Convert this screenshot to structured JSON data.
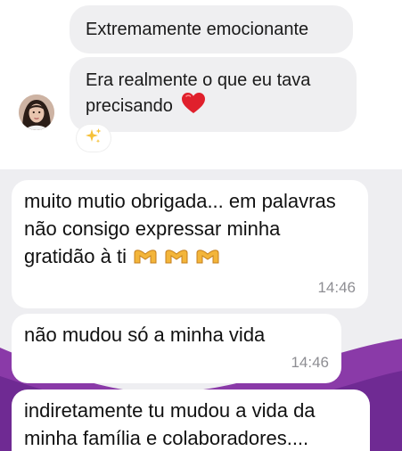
{
  "instagram": {
    "messages": [
      {
        "text": "Extremamente emocionante"
      },
      {
        "text": "Era realmente o que eu tava precisando"
      }
    ],
    "reaction": "sparkles",
    "icons": {
      "heart": "red-heart-icon",
      "reaction": "sparkles-icon",
      "avatar": "user-avatar"
    }
  },
  "whatsapp": {
    "messages": [
      {
        "text": "muito mutio obrigada... em palavras não consigo expressar minha gratidão à ti",
        "emoji": "heart-hands x3",
        "time": "14:46"
      },
      {
        "text": "não mudou só a minha vida",
        "time": "14:46"
      },
      {
        "text": "indiretamente tu mudou a vida da minha família e colaboradores...."
      }
    ],
    "colors": {
      "bubble": "#ffffff",
      "time": "#8e8e93",
      "wallpaper_accent": "#8a3aa8"
    }
  }
}
